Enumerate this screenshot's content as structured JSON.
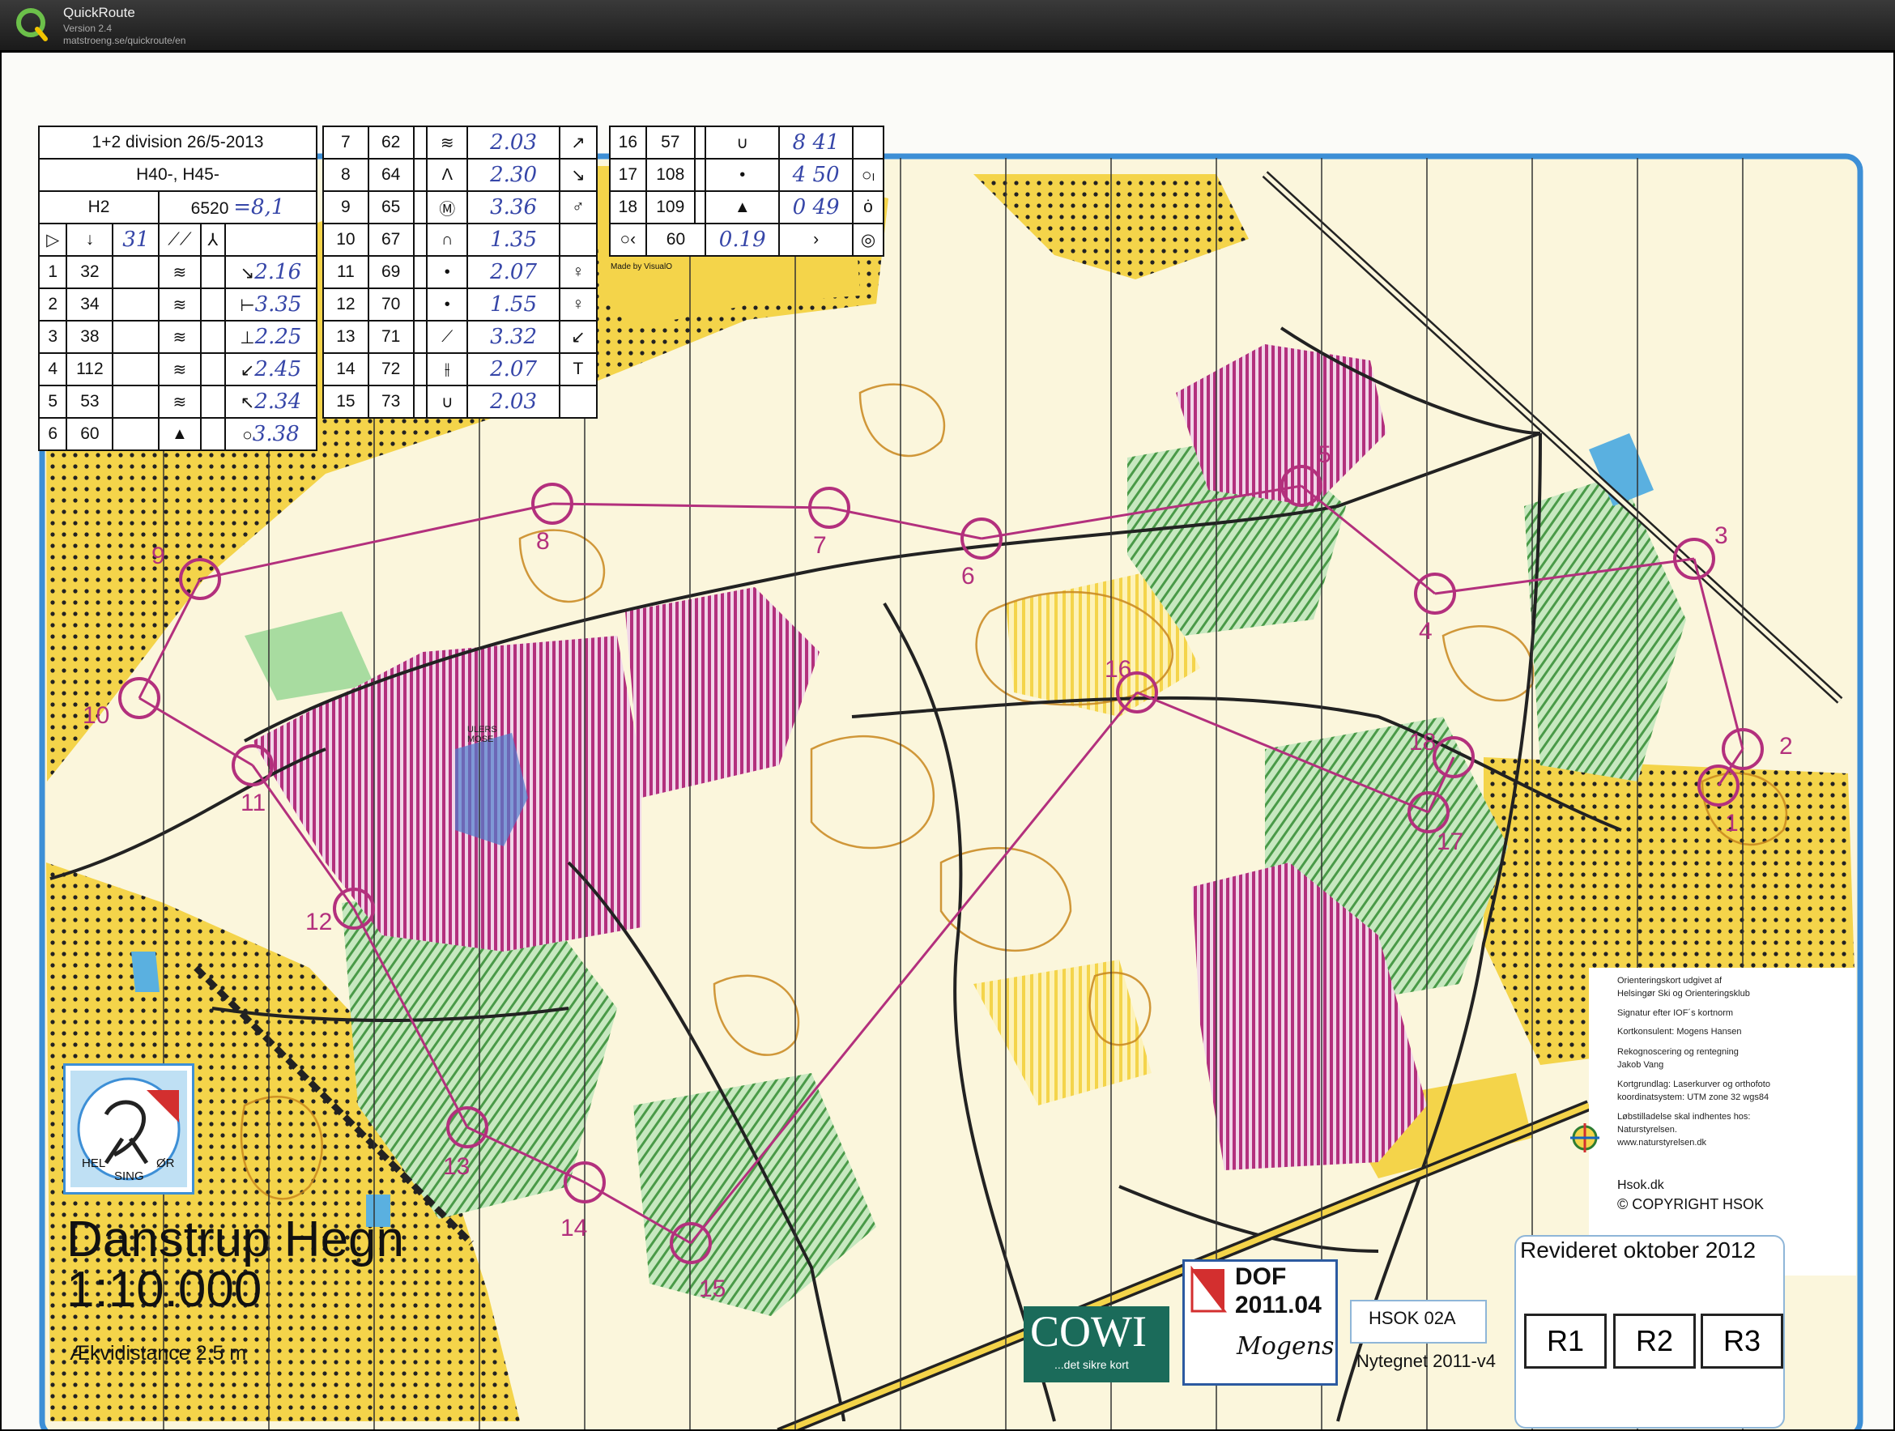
{
  "app": {
    "name": "QuickRoute",
    "version": "Version 2.4",
    "url": "matstroeng.se/quickroute/en"
  },
  "event": {
    "title": "1+2 division 26/5-2013",
    "classes": "H40-, H45-",
    "course": "H2",
    "length": "6520",
    "handwritten_km": "=8,1"
  },
  "legend_header": {
    "start_symbol": "start-triangle-icon",
    "arrow": "↓",
    "handwritten_climb": "31"
  },
  "legend_rows": [
    {
      "n": "1",
      "code": "32",
      "what": "≋",
      "where": "↘",
      "time": "2.16"
    },
    {
      "n": "2",
      "code": "34",
      "what": "≋",
      "where": "⊢",
      "time": "3.35"
    },
    {
      "n": "3",
      "code": "38",
      "what": "≋",
      "where": "⊥",
      "time": "2.25"
    },
    {
      "n": "4",
      "code": "112",
      "what": "≋",
      "where": "↙",
      "time": "2.45"
    },
    {
      "n": "5",
      "code": "53",
      "what": "≋",
      "where": "↖",
      "time": "2.34"
    },
    {
      "n": "6",
      "code": "60",
      "what": "▲",
      "where": "○",
      "time": "3.38"
    }
  ],
  "legend_rows_mid": [
    {
      "n": "7",
      "code": "62",
      "what": "≋",
      "time": "2.03",
      "where": "↗"
    },
    {
      "n": "8",
      "code": "64",
      "what": "Λ",
      "time": "2.30",
      "where": "↘"
    },
    {
      "n": "9",
      "code": "65",
      "what": "Ⓜ",
      "time": "3.36",
      "where": "♂"
    },
    {
      "n": "10",
      "code": "67",
      "what": "∩",
      "time": "1.35",
      "where": ""
    },
    {
      "n": "11",
      "code": "69",
      "what": "•",
      "time": "2.07",
      "where": "♀"
    },
    {
      "n": "12",
      "code": "70",
      "what": "•",
      "time": "1.55",
      "where": "♀"
    },
    {
      "n": "13",
      "code": "71",
      "what": "⟋",
      "time": "3.32",
      "where": "↙"
    },
    {
      "n": "14",
      "code": "72",
      "what": "⫲",
      "time": "2.07",
      "where": "T"
    },
    {
      "n": "15",
      "code": "73",
      "what": "∪",
      "time": "2.03",
      "where": ""
    }
  ],
  "legend_rows_right": [
    {
      "n": "16",
      "code": "57",
      "what": "∪",
      "time": "8 41",
      "where": ""
    },
    {
      "n": "17",
      "code": "108",
      "what": "•",
      "time": "4 50",
      "where": "○ₗ"
    },
    {
      "n": "18",
      "code": "109",
      "what": "▲",
      "time": "0 49",
      "where": "ȯ"
    }
  ],
  "legend_finish": {
    "distance": "60",
    "time": "0.19",
    "credit": "Made by VisualO"
  },
  "controls": [
    "1",
    "2",
    "3",
    "4",
    "5",
    "6",
    "7",
    "8",
    "9",
    "10",
    "11",
    "12",
    "13",
    "14",
    "15",
    "16",
    "17",
    "18"
  ],
  "area_label": "ULERS MOSE",
  "map_title": "Danstrup Hegn",
  "map_scale": "1:10.000",
  "contour": "Ækvidistance 2,5 m",
  "club_logo_text": [
    "HEL",
    "SING",
    "ØR"
  ],
  "info": [
    "Orienteringskort udgivet af",
    "Helsingør Ski og Orienteringsklub",
    "Signatur efter IOF´s kortnorm",
    "Kortkonsulent: Mogens Hansen",
    "Rekognoscering og rentegning",
    "Jakob Vang",
    "Kortgrundlag: Laserkurver og orthofoto",
    "koordinatsystem: UTM zone 32 wgs84",
    "Løbstilladelse skal indhentes hos:",
    "Naturstyrelsen.",
    "www.naturstyrelsen.dk"
  ],
  "hsok_url": "Hsok.dk",
  "copyright": "© COPYRIGHT HSOK",
  "revised": "Revideret oktober 2012",
  "r_buttons": [
    "R1",
    "R2",
    "R3"
  ],
  "cowi": {
    "name": "COWI",
    "tagline": "...det sikre kort"
  },
  "dof": {
    "name": "DOF",
    "year": "2011.04",
    "signature": "Mogens"
  },
  "hsok_code": "HSOK 02A",
  "redrawn": "Nytegnet 2011-v4",
  "colors": {
    "forest_yellow": "#f4d44a",
    "open": "#fbf6d8",
    "green": "#8fcf8a",
    "purple": "#b3307d",
    "water": "#5ab0e0",
    "contour": "#c8861c",
    "frame_blue": "#3d8fd6"
  }
}
